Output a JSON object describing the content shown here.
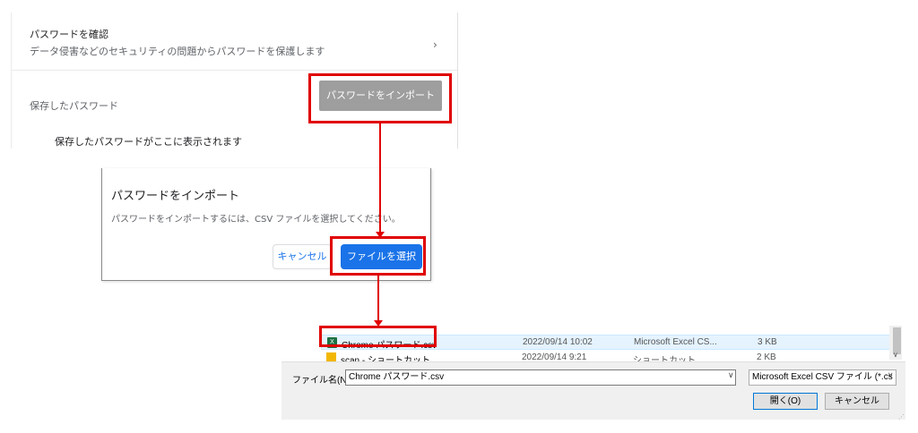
{
  "settings": {
    "check_title": "パスワードを確認",
    "check_subtitle": "データ侵害などのセキュリティの問題からパスワードを保護します",
    "chevron": "›",
    "saved_label": "保存したパスワード",
    "import_button": "パスワードをインポート",
    "empty_message": "保存したパスワードがここに表示されます"
  },
  "import_dialog": {
    "title": "パスワードをインポート",
    "body": "パスワードをインポートするには、CSV ファイルを選択してください。",
    "cancel_button": "キャンセル",
    "choose_button": "ファイルを選択"
  },
  "file_dialog": {
    "files": [
      {
        "name": "Chrome パスワード.csv",
        "date": "2022/09/14 10:02",
        "type": "Microsoft Excel CS...",
        "size": "3 KB",
        "icon": "excel-file-icon",
        "selected": true
      },
      {
        "name": "scan - ショートカット",
        "date": "2022/09/14 9:21",
        "type": "ショートカット",
        "size": "2 KB",
        "icon": "shortcut-icon",
        "selected": false
      }
    ],
    "filename_label": "ファイル名(N):",
    "filename_value": "Chrome パスワード.csv",
    "filetype_value": "Microsoft Excel CSV ファイル (*.cs",
    "open_button": "開く(O)",
    "cancel_button": "キャンセル",
    "dropdown_glyph": "∨"
  },
  "colors": {
    "annotation": "#e00000",
    "chrome_blue": "#1a73e8",
    "selection": "#e5f3ff"
  }
}
